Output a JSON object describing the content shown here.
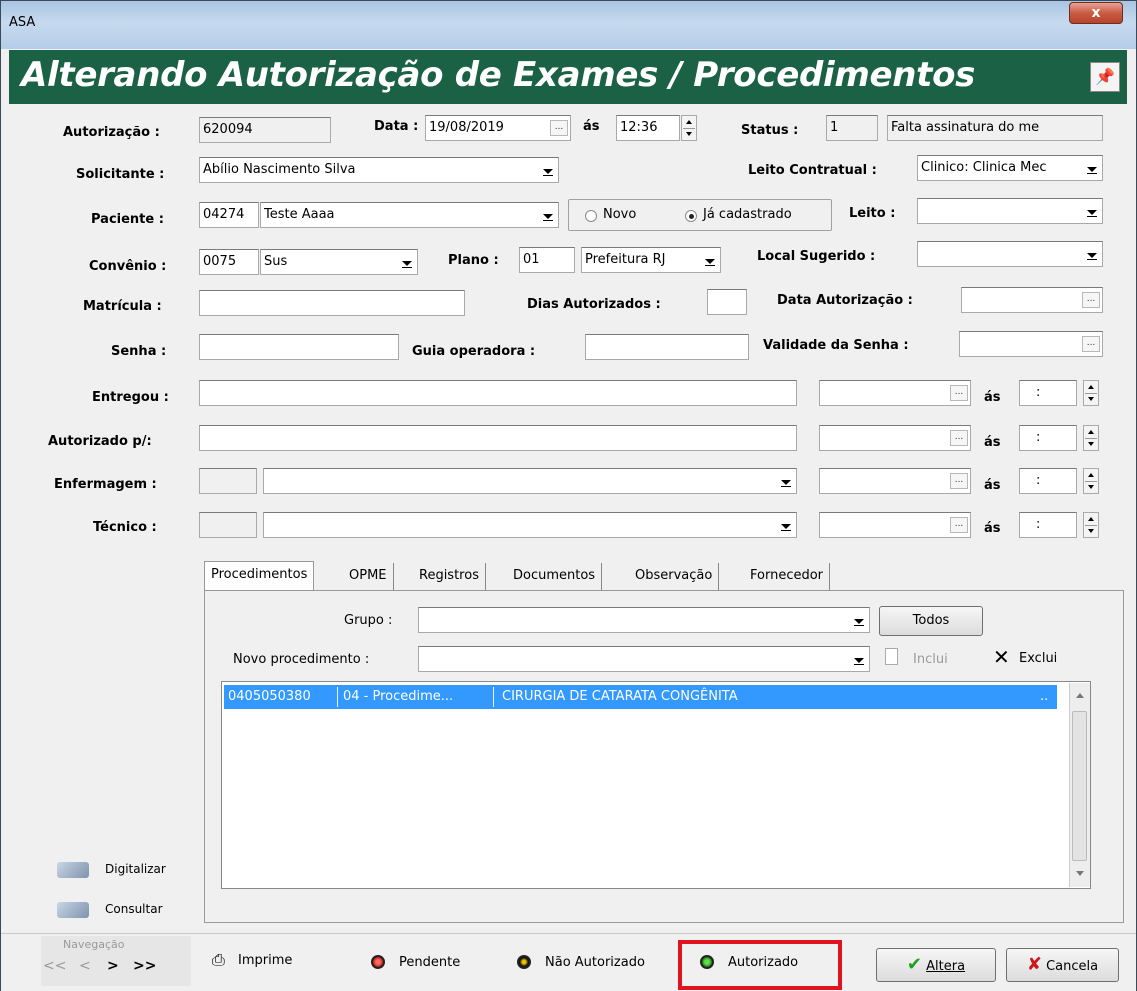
{
  "window": {
    "app_title": "ASA",
    "close_label": "x"
  },
  "header": {
    "title": "Alterando Autorização de Exames / Procedimentos"
  },
  "form": {
    "autorizacao_label": "Autorização :",
    "autorizacao_value": "620094",
    "data_label": "Data :",
    "data_value": "19/08/2019",
    "as_label": "ás",
    "hora_value": "12:36",
    "status_label": "Status :",
    "status_code": "1",
    "status_text": "Falta assinatura do me",
    "solicitante_label": "Solicitante :",
    "solicitante_value": "Abílio Nascimento Silva",
    "leito_contratual_label": "Leito Contratual :",
    "leito_contratual_value": "Clinico: Clinica Mec",
    "paciente_label": "Paciente :",
    "paciente_code": "04274",
    "paciente_name": "Teste Aaaa",
    "radio_novo": "Novo",
    "radio_cadastrado": "Já cadastrado",
    "leito_label": "Leito :",
    "leito_value": "",
    "convenio_label": "Convênio :",
    "convenio_code": "0075",
    "convenio_name": "Sus",
    "plano_label": "Plano :",
    "plano_code": "01",
    "plano_name": "Prefeitura RJ",
    "local_sugerido_label": "Local Sugerido :",
    "local_sugerido_value": "",
    "matricula_label": "Matrícula :",
    "matricula_value": "",
    "dias_autorizados_label": "Dias Autorizados :",
    "dias_autorizados_value": "",
    "data_autorizacao_label": "Data Autorização :",
    "data_autorizacao_value": "",
    "senha_label": "Senha :",
    "senha_value": "",
    "guia_label": "Guia operadora :",
    "guia_value": "",
    "validade_label": "Validade da Senha :",
    "validade_value": "",
    "entregou_label": "Entregou :",
    "autorizado_p_label": "Autorizado p/:",
    "enfermagem_label": "Enfermagem :",
    "tecnico_label": "Técnico :",
    "time_placeholder": ":",
    "dots": "..."
  },
  "tabs": [
    "Procedimentos",
    "OPME",
    "Registros",
    "Documentos",
    "Observação",
    "Fornecedor"
  ],
  "panel": {
    "grupo_label": "Grupo :",
    "grupo_value": "",
    "todos_label": "Todos",
    "novo_label": "Novo procedimento :",
    "novo_value": "",
    "inclui_label": "Inclui",
    "exclui_label": "Exclui",
    "rows": [
      {
        "code": "0405050380",
        "group": "04 - Procedime...",
        "description": "CIRURGIA DE CATARATA CONGÊNITA",
        "more": ".."
      }
    ]
  },
  "side": {
    "digitalizar": "Digitalizar",
    "consultar": "Consultar"
  },
  "bottom": {
    "navegacao": "Navegação",
    "nav_first": "<<",
    "nav_prev": "<",
    "nav_next": ">",
    "nav_last": ">>",
    "imprime": "Imprime",
    "pendente": "Pendente",
    "nao_autorizado": "Não Autorizado",
    "autorizado": "Autorizado",
    "altera": "Altera",
    "cancela": "Cancela"
  },
  "colors": {
    "header_bg": "#1a6146",
    "highlight_border": "#e0141e",
    "selection": "#3399ff"
  }
}
